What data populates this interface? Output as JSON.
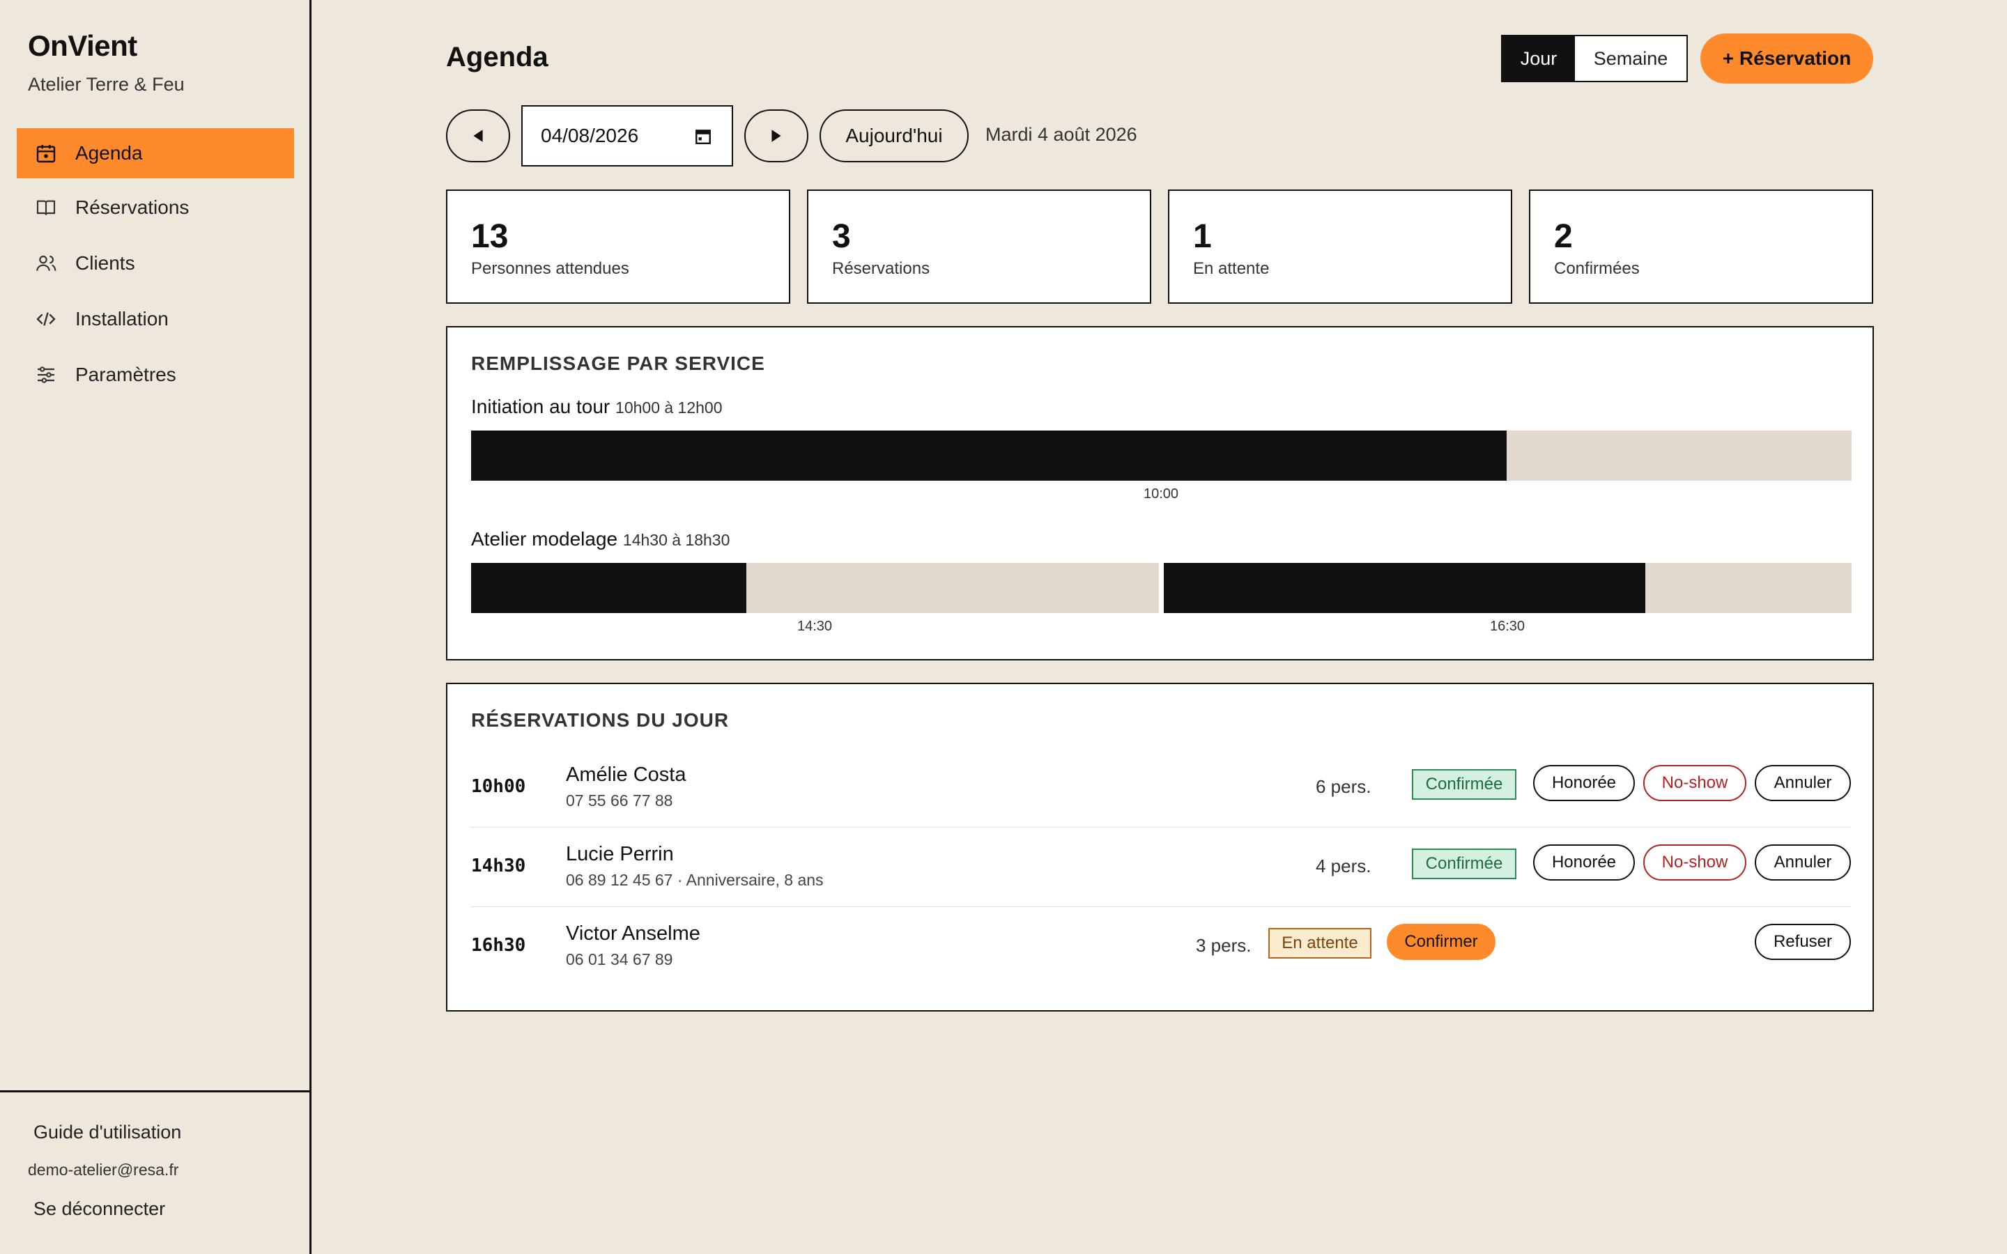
{
  "sidebar": {
    "brand": "OnVient",
    "org": "Atelier Terre & Feu",
    "items": [
      {
        "label": "Agenda",
        "icon": "calendar-icon"
      },
      {
        "label": "Réservations",
        "icon": "book-icon"
      },
      {
        "label": "Clients",
        "icon": "users-icon"
      },
      {
        "label": "Installation",
        "icon": "code-icon"
      },
      {
        "label": "Paramètres",
        "icon": "sliders-icon"
      }
    ],
    "guide": "Guide d'utilisation",
    "email": "demo-atelier@resa.fr",
    "logout": "Se déconnecter"
  },
  "header": {
    "title": "Agenda",
    "view_day": "Jour",
    "view_week": "Semaine",
    "new_button": "+ Réservation"
  },
  "nav": {
    "date_value": "04/08/2026",
    "today": "Aujourd'hui",
    "date_long": "Mardi 4 août 2026"
  },
  "stats": [
    {
      "value": "13",
      "label": "Personnes attendues"
    },
    {
      "value": "3",
      "label": "Réservations"
    },
    {
      "value": "1",
      "label": "En attente"
    },
    {
      "value": "2",
      "label": "Confirmées"
    }
  ],
  "fill": {
    "title": "REMPLISSAGE PAR SERVICE",
    "services": [
      {
        "name": "Initiation au tour",
        "hours": "10h00 à 12h00",
        "slots": [
          {
            "time": "10:00",
            "fill": 0.75
          }
        ]
      },
      {
        "name": "Atelier modelage",
        "hours": "14h30 à 18h30",
        "slots": [
          {
            "time": "14:30",
            "fill": 0.4
          },
          {
            "time": "16:30",
            "fill": 0.7
          }
        ]
      }
    ]
  },
  "reservations": {
    "title": "RÉSERVATIONS DU JOUR",
    "rows": [
      {
        "time": "10h00",
        "name": "Amélie Costa",
        "sub": "07 55 66 77 88",
        "pers": "6 pers.",
        "status": "Confirmée",
        "actions": [
          "Honorée",
          "No-show",
          "Annuler"
        ]
      },
      {
        "time": "14h30",
        "name": "Lucie Perrin",
        "sub": "06 89 12 45 67 · Anniversaire, 8 ans",
        "pers": "4 pers.",
        "status": "Confirmée",
        "actions": [
          "Honorée",
          "No-show",
          "Annuler"
        ]
      },
      {
        "time": "16h30",
        "name": "Victor Anselme",
        "sub": "06 01 34 67 89",
        "pers": "3 pers.",
        "status": "En attente",
        "actions": [
          "Confirmer",
          "Refuser"
        ]
      }
    ]
  },
  "colors": {
    "accent": "#ff8a2b",
    "background": "#ede7dc",
    "ink": "#111111"
  }
}
